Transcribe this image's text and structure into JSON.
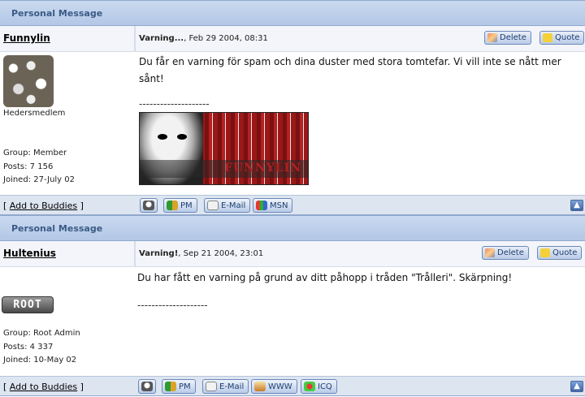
{
  "messages": [
    {
      "category_title": "Personal Message",
      "author": "Funnylin",
      "post_title": "Varning...",
      "post_date": ", Feb 29 2004, 08:31",
      "delete_label": "Delete",
      "quote_label": "Quote",
      "rank": "Hedersmedlem",
      "group": "Group: Member",
      "posts": "Posts: 7 156",
      "joined": "Joined: 27-July 02",
      "body": "Du får en varning för spam och dina duster med stora tomtefar. Vi vill inte se nått mer sånt!",
      "separator": "--------------------",
      "signature_text": "FUNNYLIN",
      "add_buddies": "Add to Buddies",
      "buttons": [
        "PM",
        "E-Mail",
        "MSN"
      ]
    },
    {
      "category_title": "Personal Message",
      "author": "Hultenius",
      "post_title": "Varning!",
      "post_date": ", Sep 21 2004, 23:01",
      "delete_label": "Delete",
      "quote_label": "Quote",
      "rank_badge": "ROOT",
      "group": "Group: Root Admin",
      "posts": "Posts: 4 337",
      "joined": "Joined: 10-May 02",
      "body": "Du har fått en varning på grund av ditt påhopp i tråden \"Trålleri\". Skärpning!",
      "separator": "--------------------",
      "add_buddies": "Add to Buddies",
      "buttons": [
        "PM",
        "E-Mail",
        "WWW",
        "ICQ"
      ]
    }
  ],
  "icons": {
    "delete": "pencil-eraser-icon",
    "quote": "speech-bubble-icon",
    "profile": "profile-icon",
    "pm": "pm-icon",
    "email": "envelope-icon",
    "msn": "msn-butterfly-icon",
    "www": "home-icon",
    "icq": "icq-flower-icon",
    "top": "arrow-up-icon"
  }
}
